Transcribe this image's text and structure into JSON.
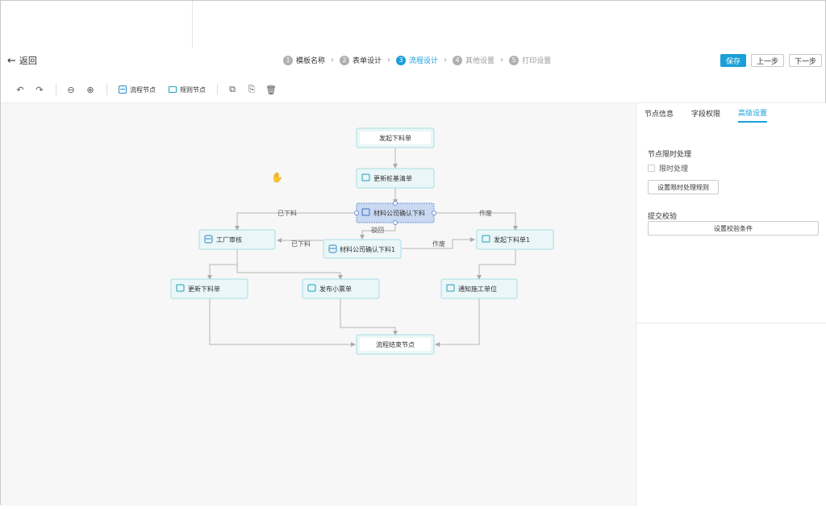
{
  "header": {
    "back_label": "返回",
    "steps": [
      {
        "num": "1",
        "label": "模板名称",
        "state": "done"
      },
      {
        "num": "2",
        "label": "表单设计",
        "state": "done"
      },
      {
        "num": "3",
        "label": "流程设计",
        "state": "active"
      },
      {
        "num": "4",
        "label": "其他设置",
        "state": "inactive"
      },
      {
        "num": "5",
        "label": "打印设置",
        "state": "inactive"
      }
    ],
    "save_label": "保存",
    "prev_label": "上一步",
    "next_label": "下一步"
  },
  "toolbar": {
    "flow_node_label": "流程节点",
    "rule_node_label": "规则节点"
  },
  "flow": {
    "nodes": {
      "start": "发起下料单",
      "update_bom": "更新桩基清单",
      "confirm": "材料公司确认下料",
      "factory": "工厂审核",
      "confirm1": "材料公司确认下料1",
      "start1": "发起下料单1",
      "update_order": "更新下料单",
      "publish": "发布小票单",
      "notify": "通知施工单位",
      "end": "流程结束节点"
    },
    "edges": {
      "issued_left": "已下料",
      "void_right": "作废",
      "reject": "驳回",
      "issued_mid": "已下料",
      "void_mid": "作废"
    }
  },
  "panel": {
    "tabs": [
      "节点信息",
      "字段权限",
      "高级设置"
    ],
    "active_tab": 2,
    "time_limit_title": "节点限时处理",
    "time_limit_checkbox": "限时处理",
    "time_limit_button": "设置限时处理规则",
    "submit_check_title": "提交校验",
    "submit_check_button": "设置校验条件"
  }
}
